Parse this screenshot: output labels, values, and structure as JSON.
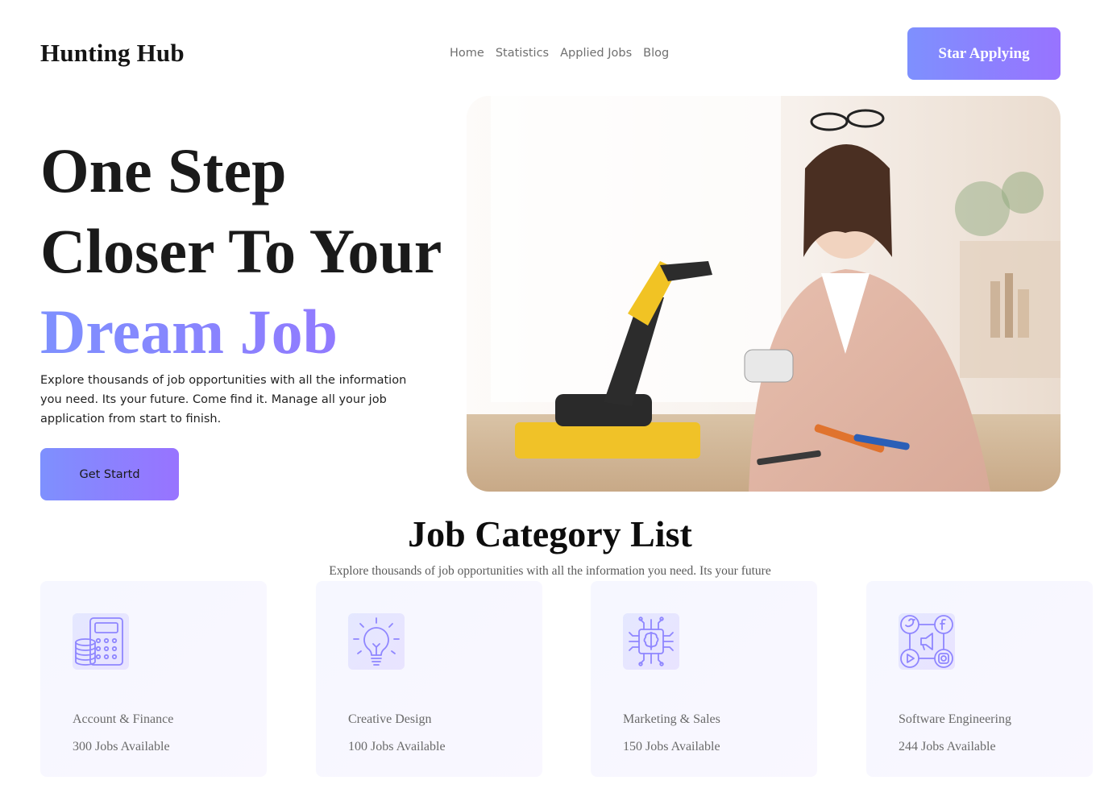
{
  "header": {
    "logo": "Hunting Hub",
    "nav": [
      "Home",
      "Statistics",
      "Applied Jobs",
      "Blog"
    ],
    "cta": "Star Applying"
  },
  "hero": {
    "title_line1": "One Step",
    "title_line2": "Closer To Your",
    "title_accent": "Dream Job",
    "description": "Explore thousands of job opportunities with all the information you need. Its your future. Come find it. Manage all your job application from start to finish.",
    "cta": "Get Startd"
  },
  "categories": {
    "title": "Job Category List",
    "subtitle": "Explore thousands of job opportunities with all the information you need. Its your future",
    "items": [
      {
        "name": "Account & Finance",
        "count": "300 Jobs Available",
        "icon": "calculator-coins-icon"
      },
      {
        "name": "Creative Design",
        "count": "100 Jobs Available",
        "icon": "lightbulb-icon"
      },
      {
        "name": "Marketing & Sales",
        "count": "150 Jobs Available",
        "icon": "chip-brain-icon"
      },
      {
        "name": "Software Engineering",
        "count": "244 Jobs Available",
        "icon": "social-media-icon"
      }
    ]
  },
  "colors": {
    "accent_start": "#7e90fe",
    "accent_end": "#9873ff",
    "heading": "#1a1a1a",
    "muted": "#6a6a6a"
  }
}
